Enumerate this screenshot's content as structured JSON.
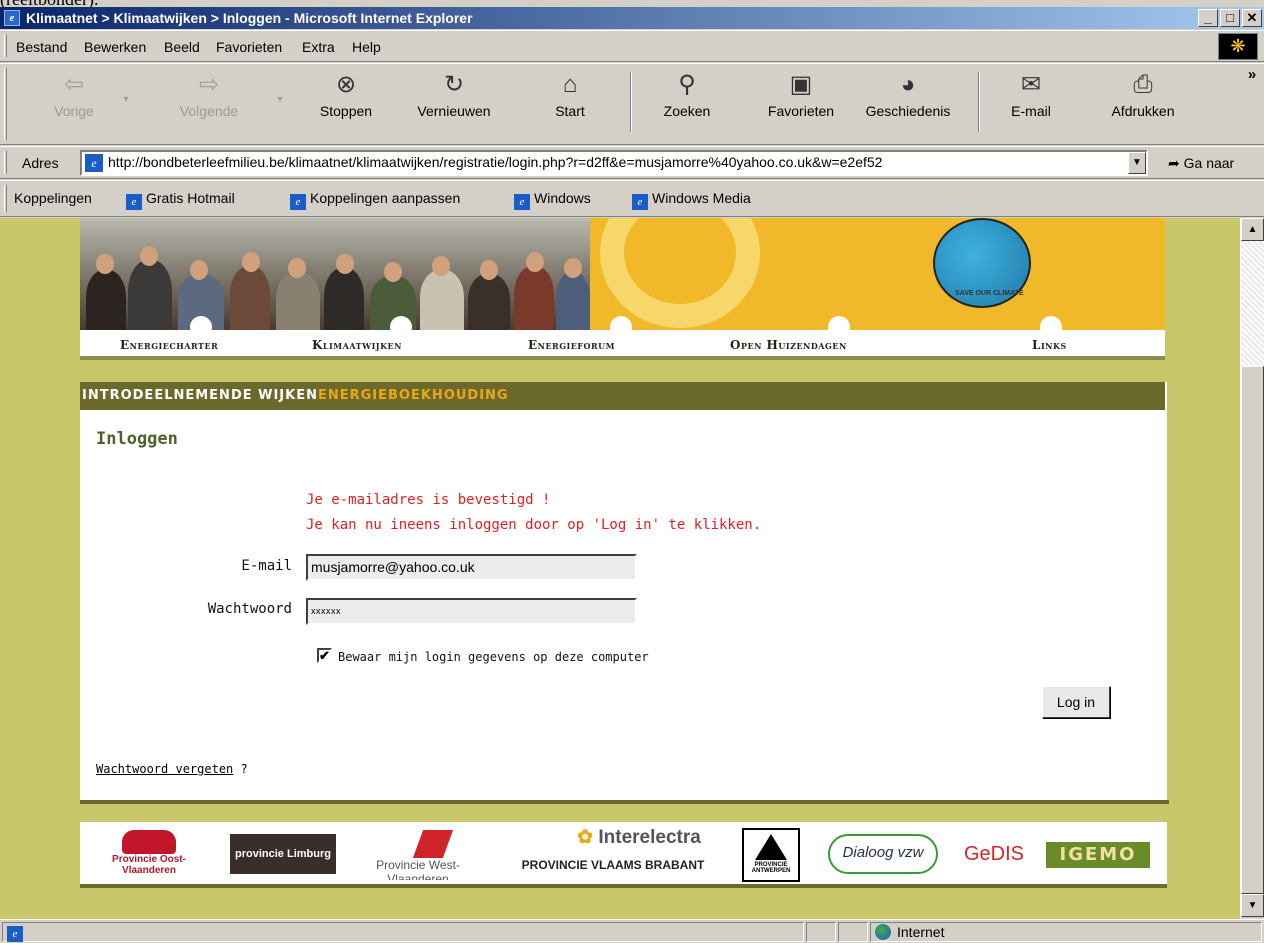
{
  "above_window_text": "(reeltbonder).",
  "window": {
    "title": "Klimaatnet > Klimaatwijken > Inloggen - Microsoft Internet Explorer",
    "controls": {
      "minimize": "_",
      "maximize": "□",
      "close": "✕"
    }
  },
  "menu": {
    "items": [
      {
        "label": "Bestand"
      },
      {
        "label": "Bewerken"
      },
      {
        "label": "Beeld"
      },
      {
        "label": "Favorieten"
      },
      {
        "label": "Extra"
      },
      {
        "label": "Help"
      }
    ]
  },
  "toolbar": {
    "back": "Vorige",
    "forward": "Volgende",
    "stop": "Stoppen",
    "refresh": "Vernieuwen",
    "home": "Start",
    "search": "Zoeken",
    "favorites": "Favorieten",
    "history": "Geschiedenis",
    "mail": "E-mail",
    "print": "Afdrukken",
    "more": "»"
  },
  "address": {
    "label": "Adres",
    "url": "http://bondbeterleefmilieu.be/klimaatnet/klimaatwijken/registratie/login.php?r=d2ff&e=musjamorre%40yahoo.co.uk&w=e2ef52",
    "go": "Ga naar"
  },
  "links": {
    "label": "Koppelingen",
    "items": [
      {
        "label": "Gratis Hotmail"
      },
      {
        "label": "Koppelingen aanpassen"
      },
      {
        "label": "Windows"
      },
      {
        "label": "Windows Media"
      }
    ]
  },
  "site": {
    "globe_text": "SAVE OUR CLIMATE",
    "nav": [
      {
        "label": "Energiecharter"
      },
      {
        "label": "Klimaatwijken"
      },
      {
        "label": "Energieforum"
      },
      {
        "label": "Open Huizendagen"
      },
      {
        "label": "Links"
      }
    ],
    "section_bar": {
      "part1": "INTRODEELNEMENDE WIJKEN",
      "part2": "ENERGIEBOEKHOUDING"
    },
    "page_title": "Inloggen",
    "messages": [
      "Je e-mailadres is bevestigd !",
      "Je kan nu ineens inloggen door op 'Log in' te klikken."
    ],
    "form": {
      "email_label": "E-mail",
      "email_value": "musjamorre@yahoo.co.uk",
      "password_label": "Wachtwoord",
      "password_value": "xxxxxx",
      "remember_label": "Bewaar mijn login gegevens op deze computer",
      "remember_checked": true,
      "submit": "Log in"
    },
    "forgot": {
      "link": "Wachtwoord vergeten",
      "suffix": " ?"
    },
    "sponsors": [
      {
        "name": "Provincie Oost-Vlaanderen"
      },
      {
        "name": "provincie Limburg"
      },
      {
        "name": "Provincie West-Vlaanderen"
      },
      {
        "name": "Interelectra"
      },
      {
        "name": "PROVINCIE VLAAMS BRABANT"
      },
      {
        "name": "PROVINCIE ANTWERPEN"
      },
      {
        "name": "Dialoog vzw"
      },
      {
        "name": "GeDIS"
      },
      {
        "name": "IGEMO"
      }
    ]
  },
  "status": {
    "zone": "Internet"
  },
  "colors": {
    "page_bg": "#c9c76a",
    "section_bar": "#6b6a2c",
    "accent_orange": "#e8a817",
    "message_red": "#e02020",
    "title_green": "#4f6128",
    "titlebar_start": "#0a246a",
    "titlebar_end": "#a6caf0"
  }
}
